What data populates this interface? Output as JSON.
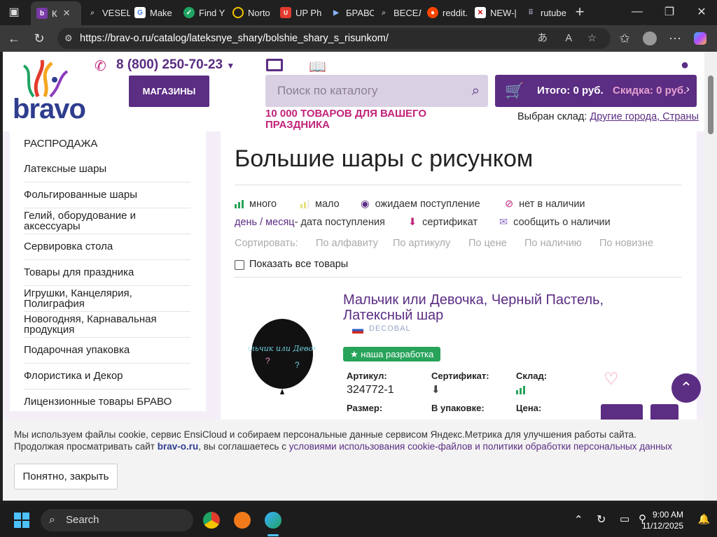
{
  "browser": {
    "tabs": [
      {
        "label": "К",
        "active": true
      },
      {
        "label": "VESEL"
      },
      {
        "label": "Make"
      },
      {
        "label": "Find Y"
      },
      {
        "label": "Norto"
      },
      {
        "label": "UP Ph"
      },
      {
        "label": "БРАВО"
      },
      {
        "label": "ВЕСЕЛ"
      },
      {
        "label": "reddit."
      },
      {
        "label": "NEW-|"
      },
      {
        "label": "rutube"
      }
    ],
    "new_tab_symbol": "+",
    "url": "https://brav-o.ru/catalog/lateksnye_shary/bolshie_shary_s_risunkom/"
  },
  "header": {
    "logo_text": "bravo",
    "phone": "8 (800) 250-70-23",
    "shops_button": "МАГАЗИНЫ",
    "search_placeholder": "Поиск по каталогу",
    "cart_total": "Итого: 0 руб.",
    "cart_discount": "Скидка: 0 руб.",
    "tagline": "10 000 ТОВАРОВ ДЛЯ ВАШЕГО ПРАЗДНИКА",
    "warehouse_label": "Выбран склад:",
    "warehouse_link": "Другие города, Страны"
  },
  "sidebar": {
    "items": [
      "РАСПРОДАЖА",
      "Латексные шары",
      "Фольгированные шары",
      "Гелий, оборудование и аксессуары",
      "Сервировка стола",
      "Товары для праздника",
      "Игрушки, Канцелярия, Полиграфия",
      "Новогодняя, Карнавальная продукция",
      "Подарочная упаковка",
      "Флористика и Декор",
      "Лицензионные товары БРАВО"
    ]
  },
  "main": {
    "title": "Большие шары с рисунком",
    "legend": {
      "many": "много",
      "few": "мало",
      "awaiting": "ожидаем поступление",
      "out": "нет в наличии",
      "date_link": "день / месяц",
      "date_text": "- дата поступления",
      "certificate": "сертификат",
      "notify": "сообщить о наличии"
    },
    "sort": {
      "label": "Сортировать:",
      "options": [
        "По алфавиту",
        "По артикулу",
        "По цене",
        "По наличию",
        "По новизне"
      ]
    },
    "show_all": "Показать все товары",
    "product": {
      "title": "Мальчик или Девочка, Черный Пастель, Латексный шар",
      "brand": "DECOBAL",
      "badge": "наша разработка",
      "article_label": "Артикул:",
      "article_value": "324772-1",
      "cert_label": "Сертификат:",
      "stock_label": "Склад:",
      "size_label": "Размер:",
      "pack_label": "В упаковке:",
      "price_label": "Цена:",
      "balloon_text": "Мальчик или Девочка"
    }
  },
  "cookie": {
    "line1": "Мы используем файлы cookie, сервис EnsiCloud и собираем персональные данные сервисом Яндекс.Метрика для улучшения работы сайта.",
    "line2_start": "Продолжая просматривать сайт ",
    "line2_site": "brav-o.ru",
    "line2_mid": ", вы соглашаетесь с ",
    "line2_link": "условиями использования cookie-файлов и политики обработки персональных данных",
    "button": "Понятно, закрыть"
  },
  "taskbar": {
    "search": "Search",
    "time": "9:00 AM",
    "date": "11/12/2025"
  },
  "colors": {
    "brand_purple": "#5b2d83",
    "accent_pink": "#c2237a",
    "green": "#27a35a"
  }
}
